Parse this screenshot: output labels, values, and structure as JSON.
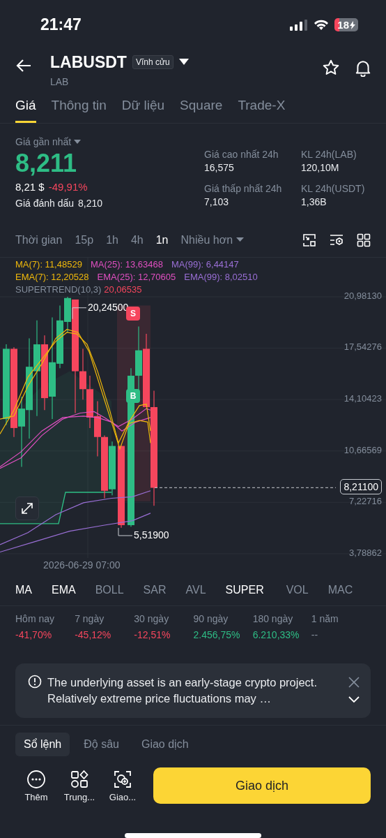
{
  "status_bar": {
    "time": "21:47",
    "battery": "18"
  },
  "header": {
    "symbol": "LABUSDT",
    "contract_type": "Vĩnh cửu",
    "base": "LAB"
  },
  "tabs": [
    {
      "label": "Giá",
      "selected": true
    },
    {
      "label": "Thông tin",
      "selected": false
    },
    {
      "label": "Dữ liệu",
      "selected": false
    },
    {
      "label": "Square",
      "selected": false
    },
    {
      "label": "Trade-X",
      "selected": false
    }
  ],
  "price": {
    "label": "Giá gần nhất",
    "last": "8,211",
    "usd": "8,21 $",
    "change": "-49,91%",
    "mark_label": "Giá đánh dấu",
    "mark": "8,210"
  },
  "stats": [
    {
      "label": "Giá cao nhất 24h",
      "value": "16,575"
    },
    {
      "label": "KL 24h(LAB)",
      "value": "120,10M"
    },
    {
      "label": "Giá thấp nhất 24h",
      "value": "7,103"
    },
    {
      "label": "KL 24h(USDT)",
      "value": "1,36B"
    }
  ],
  "intervals": {
    "label": "Thời gian",
    "items": [
      {
        "label": "15p",
        "selected": false
      },
      {
        "label": "1h",
        "selected": false
      },
      {
        "label": "4h",
        "selected": false
      },
      {
        "label": "1n",
        "selected": true
      }
    ],
    "more": "Nhiều hơn"
  },
  "legend": [
    [
      {
        "text": "MA(7): 11,48529",
        "color": "#f0b90b"
      },
      {
        "text": "MA(25): 13,63468",
        "color": "#e04fc1"
      },
      {
        "text": "MA(99): 6,44147",
        "color": "#9a6fd6"
      }
    ],
    [
      {
        "text": "EMA(7): 12,20528",
        "color": "#f0b90b"
      },
      {
        "text": "EMA(25): 12,70605",
        "color": "#e04fc1"
      },
      {
        "text": "EMA(99): 8,02510",
        "color": "#9a6fd6"
      }
    ]
  ],
  "supertrend": {
    "label": "SUPERTREND(10,3)",
    "value": "20,06535"
  },
  "chart": {
    "price_axis": [
      "20,98130",
      "17,54276",
      "14,10423",
      "10,66569",
      "7,22716",
      "3,78862"
    ],
    "high_label": "20,24500",
    "low_label": "5,51900",
    "current_price": "8,21100",
    "date_label": "2026-06-29 07:00",
    "signals": [
      {
        "kind": "sell",
        "text": "S"
      },
      {
        "kind": "buy",
        "text": "B"
      }
    ]
  },
  "indicator_tabs": [
    {
      "label": "MA",
      "selected": true
    },
    {
      "label": "EMA",
      "selected": true
    },
    {
      "label": "BOLL",
      "selected": false
    },
    {
      "label": "SAR",
      "selected": false
    },
    {
      "label": "AVL",
      "selected": false
    },
    {
      "label": "SUPER",
      "selected": true
    },
    {
      "label": "VOL",
      "selected": false
    },
    {
      "label": "MAC",
      "selected": false
    }
  ],
  "performance": [
    {
      "period": "Hôm nay",
      "value": "-41,70%",
      "color": "#f6465d"
    },
    {
      "period": "7 ngày",
      "value": "-45,12%",
      "color": "#f6465d"
    },
    {
      "period": "30 ngày",
      "value": "-12,51%",
      "color": "#f6465d"
    },
    {
      "period": "90 ngày",
      "value": "2.456,75%",
      "color": "#2ebd85"
    },
    {
      "period": "180 ngày",
      "value": "6.210,33%",
      "color": "#2ebd85"
    },
    {
      "period": "1 năm",
      "value": "--",
      "color": "#848e9c"
    }
  ],
  "notice": {
    "text": "The underlying asset is an early-stage crypto project. Relatively extreme price fluctuations may …"
  },
  "bottom_tabs": [
    {
      "label": "Sổ lệnh",
      "selected": true
    },
    {
      "label": "Độ sâu",
      "selected": false
    },
    {
      "label": "Giao dịch",
      "selected": false
    }
  ],
  "actions": [
    {
      "kind": "more",
      "label": "Thêm"
    },
    {
      "kind": "apps",
      "label": "Trung..."
    },
    {
      "kind": "scan",
      "label": "Giao..."
    }
  ],
  "trade_button": "Giao dịch"
}
